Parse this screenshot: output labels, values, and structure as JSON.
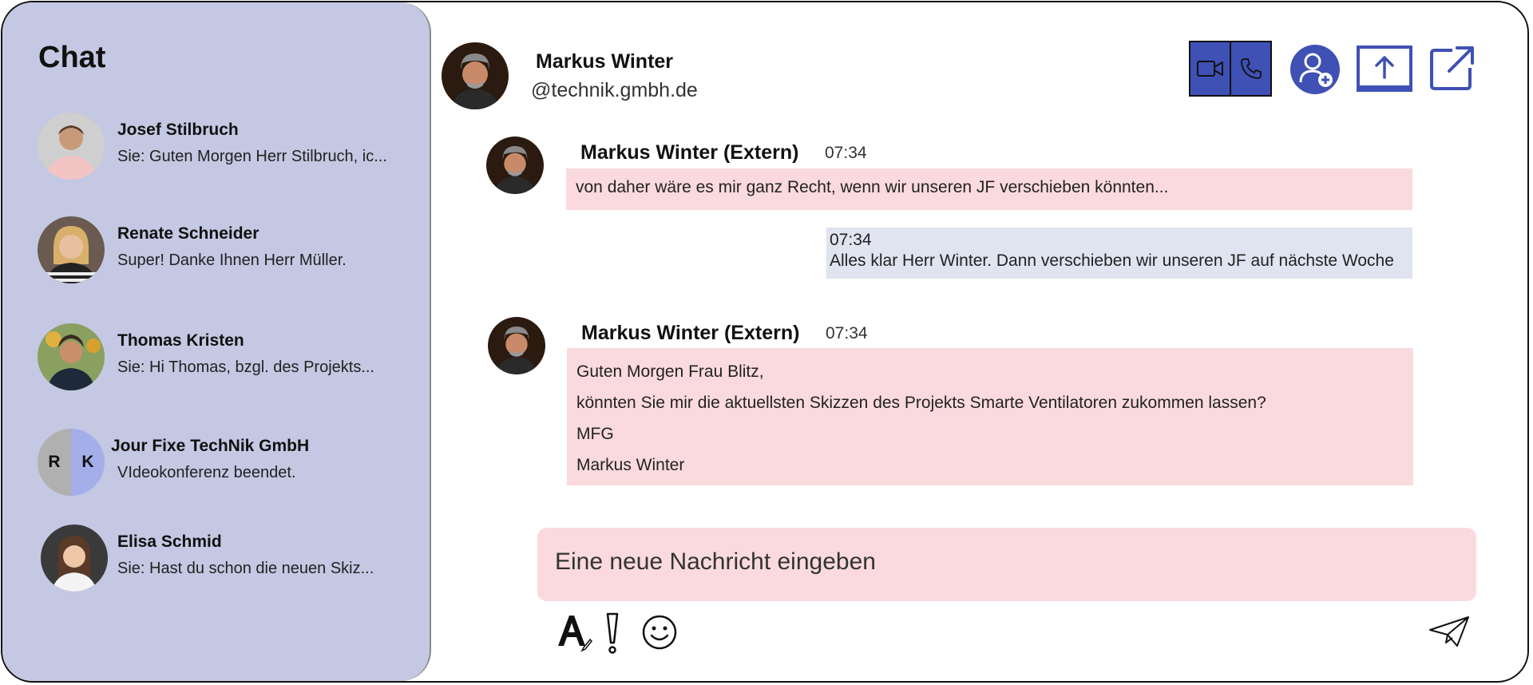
{
  "colors": {
    "sidebar_bg": "#c4c8e2",
    "accent": "#3f51b5",
    "incoming_bubble": "#fadadd",
    "outgoing_bubble": "#e0e3f0"
  },
  "sidebar": {
    "title": "Chat",
    "chats": [
      {
        "name": "Josef Stilbruch",
        "preview": "Sie: Guten Morgen Herr Stilbruch, ic..."
      },
      {
        "name": "Renate Schneider",
        "preview": "Super! Danke Ihnen Herr Müller."
      },
      {
        "name": "Thomas Kristen",
        "preview": "Sie: Hi Thomas, bzgl. des Projekts..."
      },
      {
        "name": "Jour Fixe TechNik GmbH",
        "preview": "VIdeokonferenz beendet.",
        "initials": [
          "R",
          "K"
        ]
      },
      {
        "name": "Elisa Schmid",
        "preview": "Sie: Hast du schon die neuen Skiz..."
      }
    ]
  },
  "header": {
    "name": "Markus Winter",
    "handle": "@technik.gmbh.de",
    "actions": [
      "video-call-icon",
      "phone-call-icon",
      "add-person-icon",
      "share-screen-icon",
      "pop-out-icon"
    ]
  },
  "messages": [
    {
      "sender": "Markus Winter (Extern)",
      "time": "07:34",
      "lines": [
        "von daher wäre es mir ganz Recht, wenn wir unseren JF verschieben könnten..."
      ]
    },
    {
      "time": "07:34",
      "text": "Alles klar Herr Winter. Dann verschieben wir unseren JF auf nächste Woche"
    },
    {
      "sender": "Markus Winter (Extern)",
      "time": "07:34",
      "lines": [
        "Guten Morgen Frau Blitz,",
        "könnten Sie mir die aktuellsten Skizzen des Projekts Smarte Ventilatoren zukommen lassen?",
        "MFG",
        "Markus Winter"
      ]
    }
  ],
  "composer": {
    "placeholder": "Eine neue Nachricht eingeben",
    "tools": [
      "format-text-icon",
      "important-icon",
      "emoji-icon"
    ],
    "send": "send-icon"
  }
}
